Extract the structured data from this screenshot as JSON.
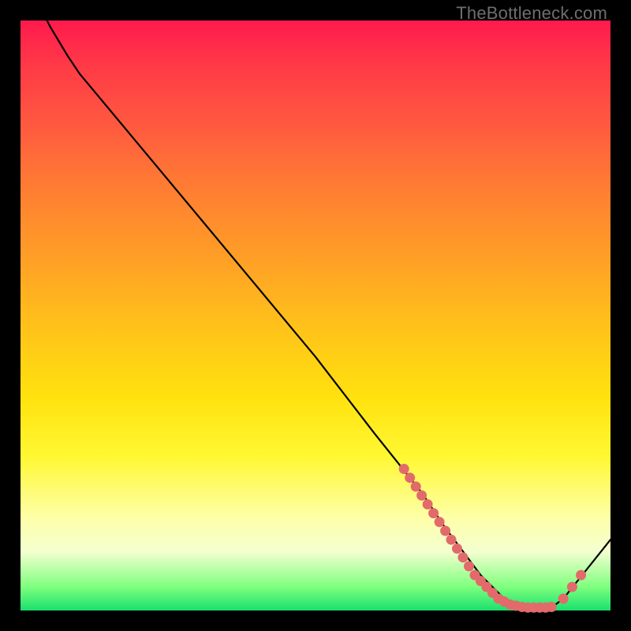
{
  "attribution": "TheBottleneck.com",
  "colors": {
    "background": "#000000",
    "curve": "#000000",
    "marker": "#e26a6a",
    "gradient_top": "#ff1a4d",
    "gradient_bottom": "#19e06e"
  },
  "chart_data": {
    "type": "line",
    "title": "",
    "xlabel": "",
    "ylabel": "",
    "xlim": [
      0,
      100
    ],
    "ylim": [
      0,
      100
    ],
    "grid": false,
    "legend": false,
    "series": [
      {
        "name": "curve",
        "x": [
          0,
          3,
          5,
          8,
          10,
          20,
          30,
          40,
          50,
          60,
          68,
          72,
          75,
          78,
          80,
          82,
          84,
          85,
          86,
          88,
          90,
          92,
          100
        ],
        "values": [
          107,
          103,
          99,
          94,
          91,
          79,
          67,
          55,
          43,
          30,
          20,
          14,
          10,
          6,
          4,
          2,
          1,
          0.5,
          0.5,
          0.5,
          0.5,
          2,
          12
        ]
      }
    ],
    "markers": [
      {
        "x": 65.0,
        "y": 24
      },
      {
        "x": 66.0,
        "y": 22.5
      },
      {
        "x": 67.0,
        "y": 21
      },
      {
        "x": 68.0,
        "y": 19.5
      },
      {
        "x": 69.0,
        "y": 18
      },
      {
        "x": 70.0,
        "y": 16.5
      },
      {
        "x": 71.0,
        "y": 15
      },
      {
        "x": 72.0,
        "y": 13.5
      },
      {
        "x": 73.0,
        "y": 12
      },
      {
        "x": 74.0,
        "y": 10.5
      },
      {
        "x": 75.0,
        "y": 9
      },
      {
        "x": 76.0,
        "y": 7.5
      },
      {
        "x": 77.0,
        "y": 6
      },
      {
        "x": 78.0,
        "y": 5
      },
      {
        "x": 79.0,
        "y": 4
      },
      {
        "x": 80.0,
        "y": 3
      },
      {
        "x": 81.0,
        "y": 2
      },
      {
        "x": 82.0,
        "y": 1.5
      },
      {
        "x": 83.0,
        "y": 1
      },
      {
        "x": 84.0,
        "y": 0.8
      },
      {
        "x": 85.0,
        "y": 0.6
      },
      {
        "x": 86.0,
        "y": 0.5
      },
      {
        "x": 87.0,
        "y": 0.5
      },
      {
        "x": 88.0,
        "y": 0.5
      },
      {
        "x": 89.0,
        "y": 0.5
      },
      {
        "x": 90.0,
        "y": 0.6
      },
      {
        "x": 92.0,
        "y": 2
      },
      {
        "x": 93.5,
        "y": 4
      },
      {
        "x": 95.0,
        "y": 6
      }
    ]
  }
}
